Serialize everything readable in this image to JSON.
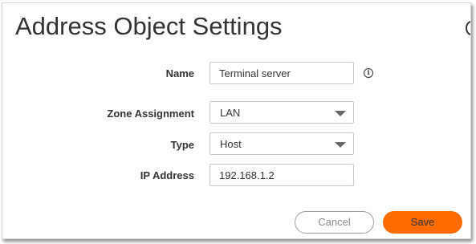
{
  "dialog": {
    "title": "Address Object Settings"
  },
  "form": {
    "name_label": "Name",
    "name_value": "Terminal server",
    "zone_label": "Zone Assignment",
    "zone_value": "LAN",
    "type_label": "Type",
    "type_value": "Host",
    "ip_label": "IP Address",
    "ip_value": "192.168.1.2"
  },
  "icons": {
    "info": "info-icon",
    "dropdown": "chevron-down-icon"
  },
  "buttons": {
    "cancel_label": "Cancel",
    "save_label": "Save"
  },
  "colors": {
    "save_bg": "#ff6b00",
    "cancel_text": "#8a8a8a",
    "title_text": "#333333"
  }
}
